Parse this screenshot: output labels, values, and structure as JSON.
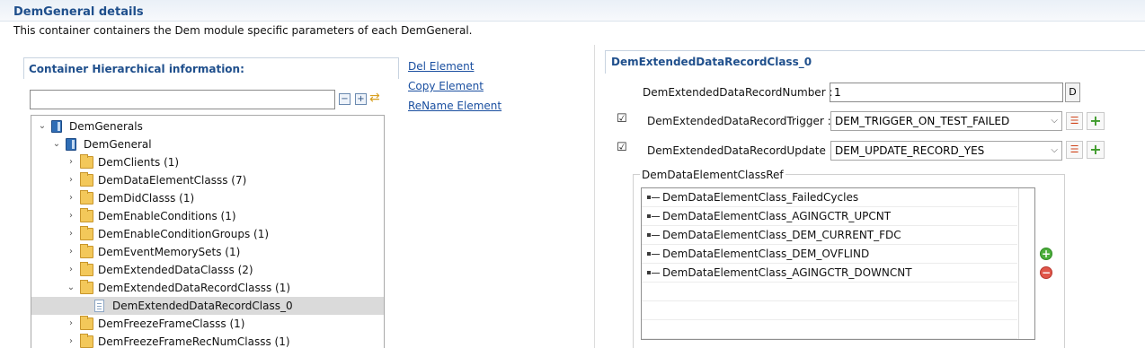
{
  "header": {
    "title": "DemGeneral details",
    "description": "This container containers the Dem module specific parameters of each DemGeneral."
  },
  "left": {
    "container_title": "Container Hierarchical information:",
    "filter_value": "",
    "tree": [
      {
        "label": "DemGenerals",
        "level": 0,
        "expanded": true,
        "icon": "module-icon"
      },
      {
        "label": "DemGeneral",
        "level": 1,
        "expanded": true,
        "icon": "module-icon"
      },
      {
        "label": "DemClients (1)",
        "level": 2,
        "expanded": false,
        "icon": "folder-icon"
      },
      {
        "label": "DemDataElementClasss (7)",
        "level": 2,
        "expanded": false,
        "icon": "folder-icon"
      },
      {
        "label": "DemDidClasss (1)",
        "level": 2,
        "expanded": false,
        "icon": "folder-icon"
      },
      {
        "label": "DemEnableConditions (1)",
        "level": 2,
        "expanded": false,
        "icon": "folder-icon"
      },
      {
        "label": "DemEnableConditionGroups (1)",
        "level": 2,
        "expanded": false,
        "icon": "folder-icon"
      },
      {
        "label": "DemEventMemorySets (1)",
        "level": 2,
        "expanded": false,
        "icon": "folder-icon"
      },
      {
        "label": "DemExtendedDataClasss (2)",
        "level": 2,
        "expanded": false,
        "icon": "folder-icon"
      },
      {
        "label": "DemExtendedDataRecordClasss (1)",
        "level": 2,
        "expanded": true,
        "icon": "folder-icon"
      },
      {
        "label": "DemExtendedDataRecordClass_0",
        "level": 3,
        "expanded": null,
        "icon": "document-icon",
        "selected": true
      },
      {
        "label": "DemFreezeFrameClasss (1)",
        "level": 2,
        "expanded": false,
        "icon": "folder-icon"
      },
      {
        "label": "DemFreezeFrameRecNumClasss (1)",
        "level": 2,
        "expanded": false,
        "icon": "folder-icon"
      }
    ],
    "actions": {
      "del": "Del Element",
      "copy": "Copy Element",
      "rename": "ReName Element"
    }
  },
  "right": {
    "title": "DemExtendedDataRecordClass_0",
    "record_number_label": "DemExtendedDataRecordNumber :",
    "record_number_value": "1",
    "d_button": "D",
    "trigger_label": "DemExtendedDataRecordTrigger :",
    "trigger_value": "DEM_TRIGGER_ON_TEST_FAILED",
    "trigger_checked": true,
    "update_label": "DemExtendedDataRecordUpdate :",
    "update_value": "DEM_UPDATE_RECORD_YES",
    "update_checked": true,
    "ref_group_label": "DemDataElementClassRef",
    "refs": [
      "DemDataElementClass_FailedCycles",
      "DemDataElementClass_AGINGCTR_UPCNT",
      "DemDataElementClass_DEM_CURRENT_FDC",
      "DemDataElementClass_DEM_OVFLIND",
      "DemDataElementClass_AGINGCTR_DOWNCNT"
    ]
  }
}
